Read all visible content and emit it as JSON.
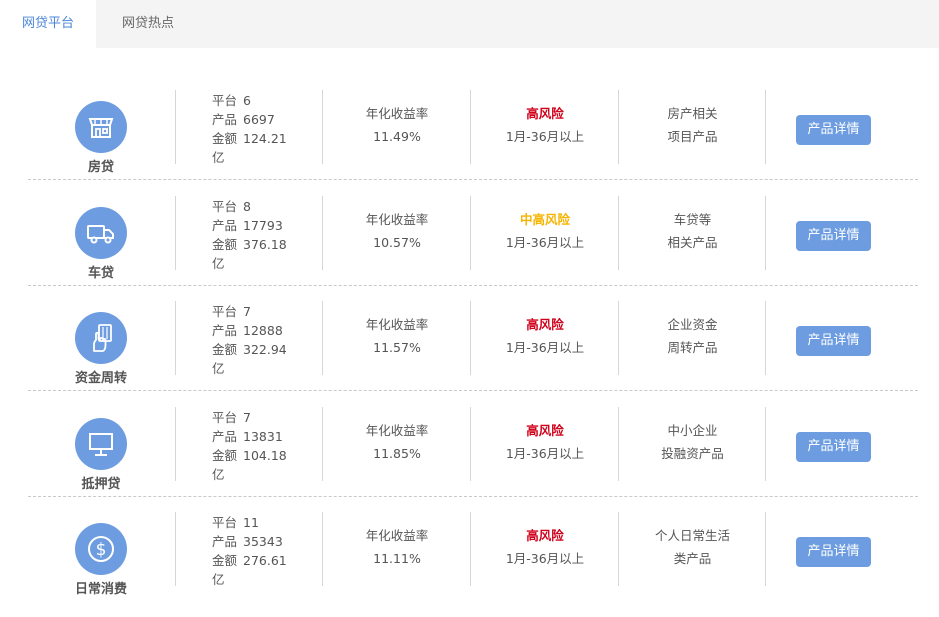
{
  "tabs": [
    {
      "label": "网贷平台",
      "active": true
    },
    {
      "label": "网贷热点",
      "active": false
    }
  ],
  "colors": {
    "accent": "#6d9de0",
    "tab_active_text": "#4a86d8",
    "risk_high": "#d0021b",
    "risk_mid_high": "#f5b400"
  },
  "rows": [
    {
      "category": "房贷",
      "icon": "storefront-icon",
      "platform_label": "平台",
      "platform": "6",
      "product_label": "产品",
      "products": "6697",
      "amount_label": "金额",
      "amount": "124.21",
      "amount_unit": "亿",
      "rate_label": "年化收益率",
      "rate": "11.49%",
      "risk": "高风险",
      "risk_level": "high",
      "term": "1月-36月以上",
      "desc1": "房产相关",
      "desc2": "项目产品",
      "button": "产品详情"
    },
    {
      "category": "车贷",
      "icon": "truck-icon",
      "platform_label": "平台",
      "platform": "8",
      "product_label": "产品",
      "products": "17793",
      "amount_label": "金额",
      "amount": "376.18",
      "amount_unit": "亿",
      "rate_label": "年化收益率",
      "rate": "10.57%",
      "risk": "中高风险",
      "risk_level": "mid",
      "term": "1月-36月以上",
      "desc1": "车贷等",
      "desc2": "相关产品",
      "button": "产品详情"
    },
    {
      "category": "资金周转",
      "icon": "hand-card-icon",
      "platform_label": "平台",
      "platform": "7",
      "product_label": "产品",
      "products": "12888",
      "amount_label": "金额",
      "amount": "322.94",
      "amount_unit": "亿",
      "rate_label": "年化收益率",
      "rate": "11.57%",
      "risk": "高风险",
      "risk_level": "high",
      "term": "1月-36月以上",
      "desc1": "企业资金",
      "desc2": "周转产品",
      "button": "产品详情"
    },
    {
      "category": "抵押贷",
      "icon": "monitor-icon",
      "platform_label": "平台",
      "platform": "7",
      "product_label": "产品",
      "products": "13831",
      "amount_label": "金额",
      "amount": "104.18",
      "amount_unit": "亿",
      "rate_label": "年化收益率",
      "rate": "11.85%",
      "risk": "高风险",
      "risk_level": "high",
      "term": "1月-36月以上",
      "desc1": "中小企业",
      "desc2": "投融资产品",
      "button": "产品详情"
    },
    {
      "category": "日常消费",
      "icon": "dollar-icon",
      "platform_label": "平台",
      "platform": "11",
      "product_label": "产品",
      "products": "35343",
      "amount_label": "金额",
      "amount": "276.61",
      "amount_unit": "亿",
      "rate_label": "年化收益率",
      "rate": "11.11%",
      "risk": "高风险",
      "risk_level": "high",
      "term": "1月-36月以上",
      "desc1": "个人日常生活",
      "desc2": "类产品",
      "button": "产品详情"
    }
  ]
}
